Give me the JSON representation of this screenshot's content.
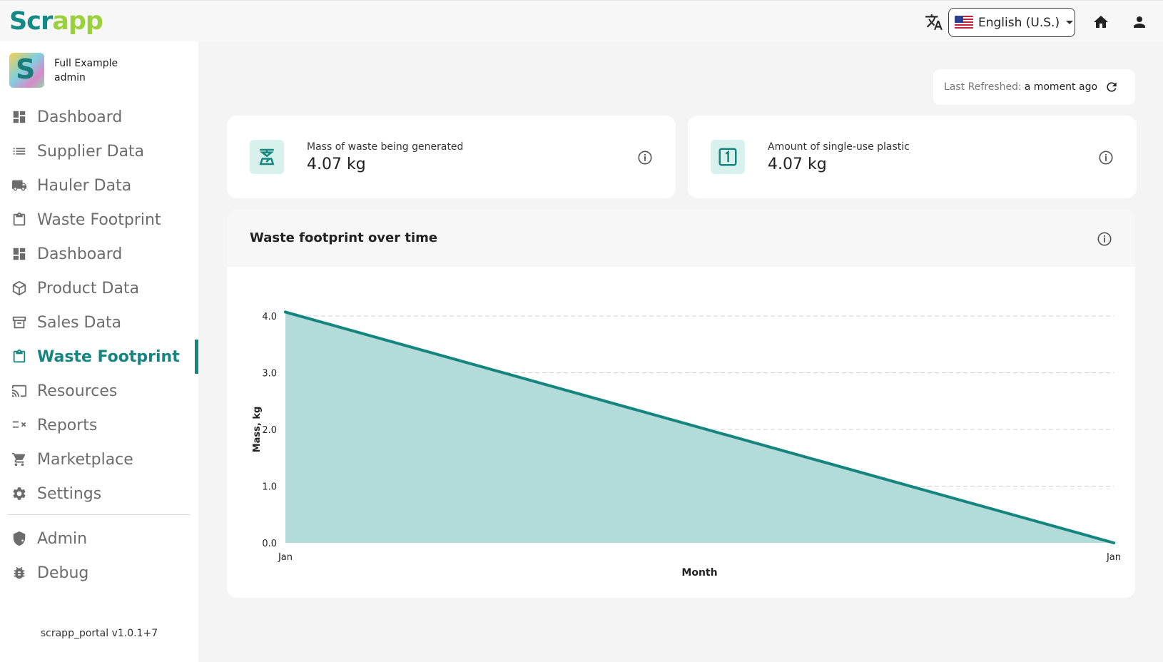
{
  "header": {
    "logo_part1": "Scr",
    "logo_part2": "app",
    "language": "English (U.S.)"
  },
  "account": {
    "name": "Full Example",
    "role": "admin"
  },
  "sidebar": {
    "items": [
      {
        "label": "Dashboard",
        "icon": "dashboard-icon"
      },
      {
        "label": "Supplier Data",
        "icon": "list-icon"
      },
      {
        "label": "Hauler Data",
        "icon": "truck-icon"
      },
      {
        "label": "Waste Footprint",
        "icon": "clipboard-icon"
      },
      {
        "label": "Dashboard",
        "icon": "dashboard-icon"
      },
      {
        "label": "Product Data",
        "icon": "box-icon"
      },
      {
        "label": "Sales Data",
        "icon": "archive-icon"
      },
      {
        "label": "Waste Footprint",
        "icon": "clipboard-icon",
        "active": true
      },
      {
        "label": "Resources",
        "icon": "cast-icon"
      },
      {
        "label": "Reports",
        "icon": "rule-icon"
      },
      {
        "label": "Marketplace",
        "icon": "cart-icon"
      },
      {
        "label": "Settings",
        "icon": "gear-icon"
      }
    ],
    "secondary": [
      {
        "label": "Admin",
        "icon": "admin-shield-icon"
      },
      {
        "label": "Debug",
        "icon": "bug-icon"
      }
    ],
    "version": "scrapp_portal v1.0.1+7"
  },
  "refresh": {
    "label": "Last Refreshed:",
    "value": "a moment ago"
  },
  "stats": [
    {
      "label": "Mass of waste being generated",
      "value": "4.07 kg",
      "icon": "scale-icon"
    },
    {
      "label": "Amount of single-use plastic",
      "value": "4.07 kg",
      "icon": "numeric-one-box-icon"
    }
  ],
  "chart": {
    "title": "Waste footprint over time"
  },
  "colors": {
    "accent": "#14857f",
    "accent_fill": "#b2dbda",
    "logo_green": "#9bd13d"
  },
  "chart_data": {
    "type": "area",
    "x": [
      "Jan",
      "Jan"
    ],
    "series": [
      {
        "values": [
          4.07,
          0.0
        ]
      }
    ],
    "xlabel": "Month",
    "ylabel": "Mass, kg",
    "ylim": [
      0,
      4.0
    ],
    "yticks": [
      "0.0",
      "1.0",
      "2.0",
      "3.0",
      "4.0"
    ],
    "grid": true
  }
}
